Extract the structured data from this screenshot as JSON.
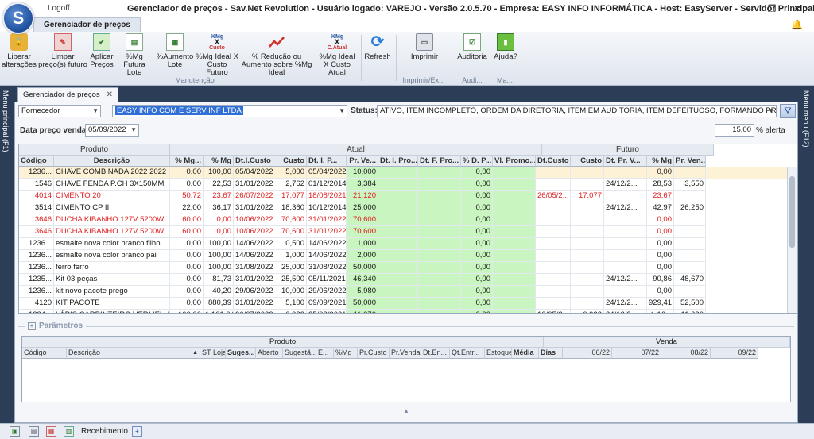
{
  "window": {
    "logoff": "Logoff",
    "title": "Gerenciador de preços - Sav.Net Revolution - Usuário logado: VAREJO - Versão 2.0.5.70 - Empresa: EASY INFO INFORMÁTICA - Host: EasyServer - Servidor Principal:[SIM]",
    "minimize_glyph": "—",
    "restore_glyph": "❐",
    "close_glyph": "✕"
  },
  "ribbon": {
    "tab": "Gerenciador de preços",
    "buttons": [
      {
        "label": "Liberar alterações",
        "icon": "unlock-icon"
      },
      {
        "label": "Limpar preço(s) futuro",
        "icon": "eraser-icon"
      },
      {
        "label": "Aplicar Preços",
        "icon": "apply-prices-icon"
      },
      {
        "label": "%Mg Futura Lote",
        "icon": "margin-future-icon"
      },
      {
        "label": "%Aumento Lote",
        "icon": "increase-batch-icon"
      },
      {
        "label": "%Mg Ideal X Custo Futuro",
        "icon": "margin-ideal-future-icon"
      },
      {
        "label": "% Redução ou Aumento sobre %Mg Ideal",
        "icon": "trend-icon"
      },
      {
        "label": "%Mg Ideal X Custo Atual",
        "icon": "margin-ideal-current-icon"
      },
      {
        "label": "Refresh",
        "icon": "refresh-icon"
      },
      {
        "label": "Imprimir",
        "icon": "printer-icon"
      },
      {
        "label": "Auditoria",
        "icon": "audit-icon"
      },
      {
        "label": "Ajuda?",
        "icon": "help-book-icon"
      }
    ],
    "icon_texts": {
      "mg_ideal_top": "%Mg",
      "mg_ideal_mid": "X",
      "mg_ideal_custo": "Custo",
      "mg_atual_bot": "C.Atual"
    },
    "groups": [
      "Manutenção",
      "Imprimir/Ex...",
      "Audi...",
      "Ma..."
    ]
  },
  "side": {
    "left": "Menu principal (F1)",
    "right": "Menu menu (F12)"
  },
  "doc_tab": {
    "label": "Gerenciador de preços",
    "close": "✕"
  },
  "filters": {
    "field": "Fornecedor",
    "value": "EASY INFO COM E SERV INF LTDA",
    "status_label": "Status:",
    "status_value": "ATIVO, ITEM INCOMPLETO, ORDEM DA DIRETORIA, ITEM EM AUDITORIA, ITEM DEFEITUOSO, FORMANDO PREÇO, LIQUIDANDO E...",
    "date_label": "Data preço venda:",
    "date_value": "05/09/2022",
    "alert_value": "15,00",
    "alert_unit": "% alerta"
  },
  "grid": {
    "bands": {
      "produto": "Produto",
      "atual": "Atual",
      "futuro": "Futuro"
    },
    "columns": [
      "Código",
      "Descrição",
      "% Mg...",
      "% Mg",
      "Dt.I.Custo",
      "Custo",
      "Dt. I. P...",
      "Pr. Ve...",
      "Dt. I. Pro...",
      "Dt. F. Pro...",
      "% D. P...",
      "Vl. Promo...",
      "Dt.Custo",
      "Custo",
      "Dt. Pr. V...",
      "% Mg",
      "Pr. Ven..."
    ],
    "rows": [
      {
        "c": [
          "1236...",
          "CHAVE COMBINADA 2022 2022",
          "0,00",
          "100,00",
          "05/04/2022",
          "5,000",
          "05/04/2022",
          "10,000",
          "",
          "",
          "0,00",
          "",
          "",
          "",
          "",
          "0,00",
          ""
        ],
        "red": false,
        "sel": true
      },
      {
        "c": [
          "1546",
          "CHAVE FENDA P.CH 3X150MM",
          "0,00",
          "22,53",
          "31/01/2022",
          "2,762",
          "01/12/2014",
          "3,384",
          "",
          "",
          "0,00",
          "",
          "",
          "",
          "24/12/2...",
          "28,53",
          "3,550"
        ],
        "red": false,
        "sel": false
      },
      {
        "c": [
          "4014",
          "CIMENTO 20",
          "50,72",
          "23,67",
          "26/07/2022",
          "17,077",
          "18/08/2021",
          "21,120",
          "",
          "",
          "0,00",
          "",
          "26/05/2...",
          "17,077",
          "",
          "23,67",
          ""
        ],
        "red": true,
        "sel": false
      },
      {
        "c": [
          "3514",
          "CIMENTO CP III",
          "22,00",
          "36,17",
          "31/01/2022",
          "18,360",
          "10/12/2014",
          "25,000",
          "",
          "",
          "0,00",
          "",
          "",
          "",
          "24/12/2...",
          "42,97",
          "26,250"
        ],
        "red": false,
        "sel": false
      },
      {
        "c": [
          "3646",
          "DUCHA KIBANHO 127V 5200W...",
          "60,00",
          "0,00",
          "10/06/2022",
          "70,600",
          "31/01/2022",
          "70,600",
          "",
          "",
          "0,00",
          "",
          "",
          "",
          "",
          "0,00",
          ""
        ],
        "red": true,
        "sel": false
      },
      {
        "c": [
          "3646",
          "DUCHA KIBANHO 127V 5200W...",
          "60,00",
          "0,00",
          "10/06/2022",
          "70,600",
          "31/01/2022",
          "70,600",
          "",
          "",
          "0,00",
          "",
          "",
          "",
          "",
          "0,00",
          ""
        ],
        "red": true,
        "sel": false
      },
      {
        "c": [
          "1236...",
          "esmalte nova color branco filho",
          "0,00",
          "100,00",
          "14/06/2022",
          "0,500",
          "14/06/2022",
          "1,000",
          "",
          "",
          "0,00",
          "",
          "",
          "",
          "",
          "0,00",
          ""
        ],
        "red": false,
        "sel": false
      },
      {
        "c": [
          "1236...",
          "esmalte nova color branco pai",
          "0,00",
          "100,00",
          "14/06/2022",
          "1,000",
          "14/06/2022",
          "2,000",
          "",
          "",
          "0,00",
          "",
          "",
          "",
          "",
          "0,00",
          ""
        ],
        "red": false,
        "sel": false
      },
      {
        "c": [
          "1236...",
          "ferro ferro",
          "0,00",
          "100,00",
          "31/08/2022",
          "25,000",
          "31/08/2022",
          "50,000",
          "",
          "",
          "0,00",
          "",
          "",
          "",
          "",
          "0,00",
          ""
        ],
        "red": false,
        "sel": false
      },
      {
        "c": [
          "1235...",
          "Kit 03 peças",
          "0,00",
          "81,73",
          "31/01/2022",
          "25,500",
          "05/11/2021",
          "46,340",
          "",
          "",
          "0,00",
          "",
          "",
          "",
          "24/12/2...",
          "90,86",
          "48,670"
        ],
        "red": false,
        "sel": false
      },
      {
        "c": [
          "1236...",
          "kit novo pacote prego",
          "0,00",
          "-40,20",
          "29/06/2022",
          "10,000",
          "29/06/2022",
          "5,980",
          "",
          "",
          "0,00",
          "",
          "",
          "",
          "",
          "0,00",
          ""
        ],
        "red": false,
        "sel": false
      },
      {
        "c": [
          "4120",
          "KIT PACOTE",
          "0,00",
          "880,39",
          "31/01/2022",
          "5,100",
          "09/09/2021",
          "50,000",
          "",
          "",
          "0,00",
          "",
          "",
          "",
          "24/12/2...",
          "929,41",
          "52,500"
        ],
        "red": false,
        "sel": false
      },
      {
        "c": [
          "1234...",
          "LÁPIS CARPINTEIRO VERMELHO BRAS...",
          "100,00",
          "1.101,04",
          "26/07/2022",
          "0,922",
          "25/08/2021",
          "11,070",
          "",
          "",
          "0,00",
          "",
          "10/05/2...",
          "0,922",
          "24/12/2...",
          "1.16...",
          "11,620"
        ],
        "red": false,
        "sel": false
      }
    ]
  },
  "params": {
    "label": "Parâmetros",
    "plus": "+"
  },
  "grid2": {
    "bands": {
      "produto": "Produto",
      "venda": "Venda"
    },
    "columns": [
      "Código",
      "Descrição",
      "ST",
      "Loja",
      "Suges...",
      "Aberto",
      "Sugestã...",
      "E...",
      "%Mg",
      "Pr.Custo",
      "Pr.Venda",
      "Dt.En...",
      "Qt.Entr...",
      "Estoque",
      "Média",
      "Dias",
      "06/22",
      "07/22",
      "08/22",
      "09/22"
    ],
    "sort_glyph": "▲"
  },
  "grip": "▲",
  "status": {
    "text": "Recebimento"
  }
}
